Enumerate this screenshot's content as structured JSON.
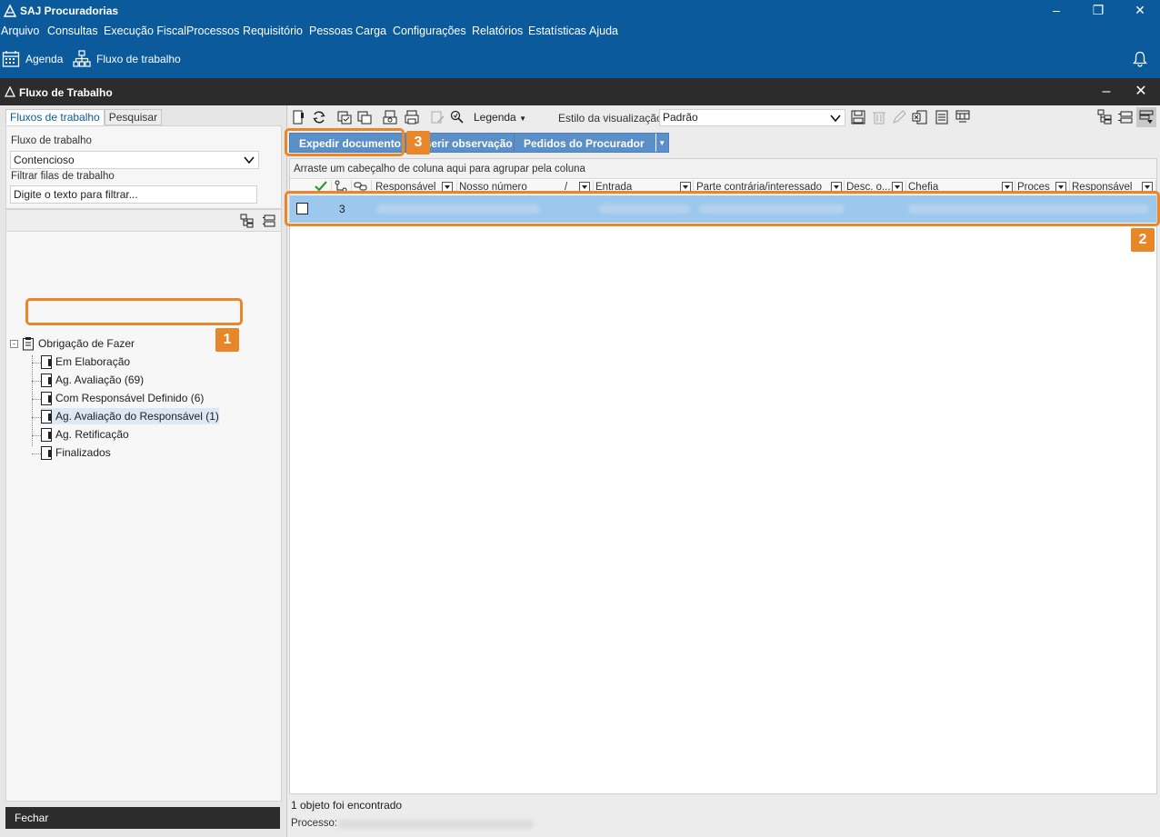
{
  "app": {
    "title": "SAJ Procuradorias"
  },
  "menu": [
    "Arquivo",
    "Consultas",
    "Execução Fiscal",
    "Processos",
    "Requisitório",
    "Pessoas",
    "Carga",
    "Configurações",
    "Relatórios",
    "Estatísticas",
    "Ajuda"
  ],
  "toolbar": {
    "agenda": "Agenda",
    "fluxo": "Fluxo de trabalho"
  },
  "window": {
    "title": "Fluxo de Trabalho"
  },
  "left": {
    "tabs": [
      "Fluxos de trabalho",
      "Pesquisar"
    ],
    "fluxo_label": "Fluxo de trabalho",
    "fluxo_value": "Contencioso",
    "filter_label": "Filtrar filas de trabalho",
    "filter_placeholder": "Digite o texto para filtrar...",
    "tree": {
      "root": "Obrigação de Fazer",
      "items": [
        "Em Elaboração",
        "Ag. Avaliação (69)",
        "Com Responsável Definido (6)",
        "Ag. Avaliação do Responsável (1)",
        "Ag. Retificação",
        "Finalizados"
      ],
      "selected_index": 3
    },
    "close_label": "Fechar"
  },
  "right": {
    "legend_label": "Legenda",
    "style_label": "Estilo da visualização",
    "style_value": "Padrão",
    "buttons": {
      "expedir": "Expedir documento",
      "inserir": "Inserir observação",
      "pedidos": "Pedidos do Procurador"
    },
    "group_hint": "Arraste um cabeçalho de coluna aqui para agrupar pela coluna",
    "columns": [
      "Responsável",
      "Nosso número",
      "Entrada",
      "Parte contrária/interessado",
      "Desc. o...",
      "Chefia",
      "Proces",
      "Responsável"
    ],
    "row": {
      "count": "3"
    },
    "status": "1 objeto foi encontrado",
    "process_label": "Processo:"
  },
  "markers": [
    "1",
    "2",
    "3"
  ],
  "colors": {
    "brand": "#0b5a9b",
    "highlight": "#e8862a",
    "button": "#5b8fc7",
    "row_selected": "#9cc8ee"
  }
}
